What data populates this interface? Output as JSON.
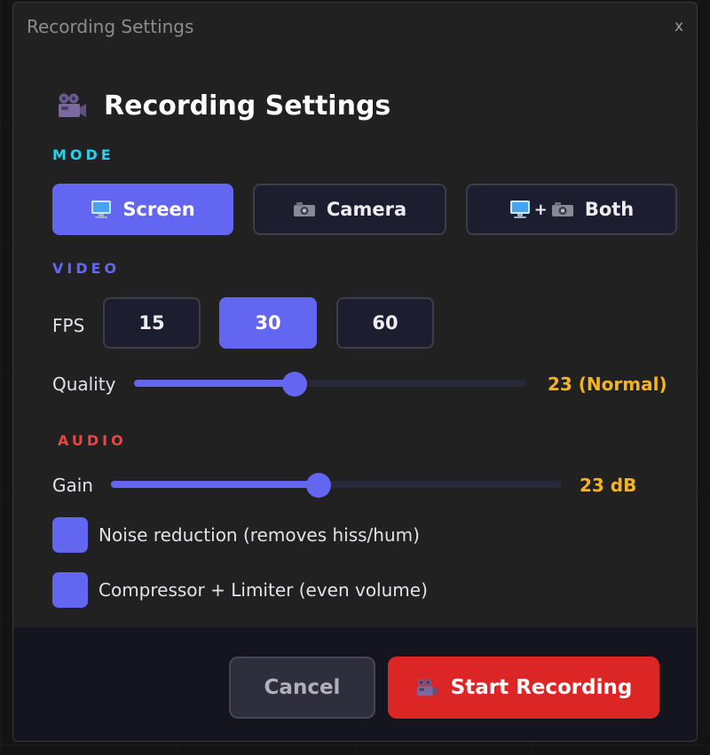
{
  "window": {
    "title": "Recording Settings",
    "close_label": "x"
  },
  "heading": {
    "icon": "movie-camera-icon",
    "title": "Recording Settings"
  },
  "mode": {
    "label": "MODE",
    "options": [
      {
        "label": "Screen",
        "icon": "monitor-icon",
        "selected": true
      },
      {
        "label": "Camera",
        "icon": "camera-icon",
        "selected": false
      },
      {
        "label": "Both",
        "icon": "monitor-plus-camera-icon",
        "plus": "+",
        "selected": false
      }
    ]
  },
  "video": {
    "label": "VIDEO",
    "fps_label": "FPS",
    "fps_options": [
      {
        "label": "15",
        "selected": false
      },
      {
        "label": "30",
        "selected": true
      },
      {
        "label": "60",
        "selected": false
      }
    ],
    "quality_label": "Quality",
    "quality_fraction": 0.41,
    "quality_value": "23 (Normal)"
  },
  "audio": {
    "label": "AUDIO",
    "gain_label": "Gain",
    "gain_fraction": 0.46,
    "gain_value": "23 dB",
    "noise_reduction_label": "Noise reduction (removes hiss/hum)",
    "noise_reduction_checked": true,
    "compressor_label": "Compressor + Limiter (even volume)",
    "compressor_checked": true
  },
  "footer": {
    "cancel_label": "Cancel",
    "start_label": "Start Recording",
    "start_icon": "movie-camera-icon"
  },
  "colors": {
    "accent": "#6366f1",
    "mode_label": "#22d3ee",
    "video_label": "#6366f1",
    "audio_label": "#ef4444",
    "readout": "#f4b41a",
    "danger": "#dc2626"
  }
}
